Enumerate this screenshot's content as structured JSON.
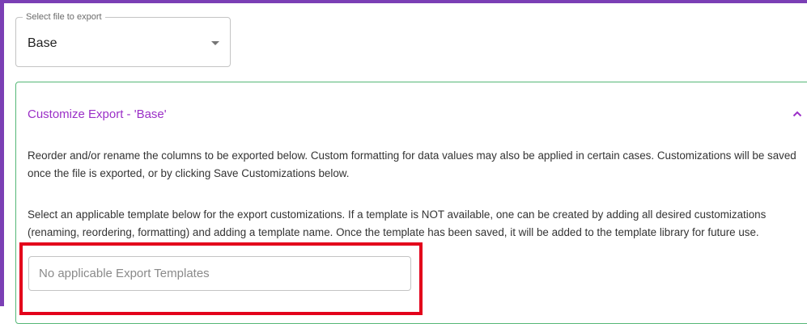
{
  "file_select": {
    "label": "Select file to export",
    "value": "Base"
  },
  "customize_panel": {
    "title": "Customize Export - 'Base'",
    "expanded": true,
    "description_1": "Reorder and/or rename the columns to be exported below. Custom formatting for data values may also be applied in certain cases. Customizations will be saved once the file is exported, or by clicking Save Customizations below.",
    "description_2": "Select an applicable template below for the export customizations. If a template is NOT available, one can be created by adding all desired customizations (renaming, reordering, formatting) and adding a template name. Once the template has been saved, it will be added to the template library for future use.",
    "template_input": {
      "value": "",
      "placeholder": "No applicable Export Templates"
    }
  },
  "colors": {
    "frame": "#7b3fb5",
    "panel_border": "#55b777",
    "title": "#9b2fc7",
    "highlight": "#e3001b"
  },
  "icons": {
    "dropdown": "chevron-down-icon",
    "collapse": "chevron-up-icon"
  }
}
